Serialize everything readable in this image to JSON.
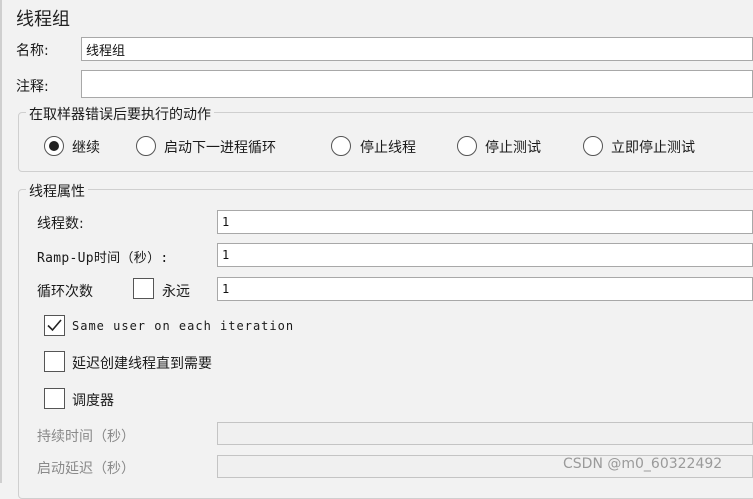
{
  "panel": {
    "title": "线程组"
  },
  "fields": {
    "name_label": "名称:",
    "name_value": "线程组",
    "comment_label": "注释:",
    "comment_value": ""
  },
  "error_action": {
    "legend": "在取样器错误后要执行的动作",
    "options": [
      {
        "label": "继续",
        "selected": true
      },
      {
        "label": "启动下一进程循环",
        "selected": false
      },
      {
        "label": "停止线程",
        "selected": false
      },
      {
        "label": "停止测试",
        "selected": false
      },
      {
        "label": "立即停止测试",
        "selected": false
      }
    ]
  },
  "thread_props": {
    "legend": "线程属性",
    "threads_label": "线程数:",
    "threads_value": "1",
    "rampup_label": "Ramp-Up时间（秒）:",
    "rampup_value": "1",
    "loop_label": "循环次数",
    "forever_label": "永远",
    "forever_checked": false,
    "loop_value": "1",
    "same_user_label": "Same user on each iteration",
    "same_user_checked": true,
    "delay_label": "延迟创建线程直到需要",
    "delay_checked": false,
    "scheduler_label": "调度器",
    "scheduler_checked": false,
    "duration_label": "持续时间（秒）",
    "duration_value": "",
    "startup_delay_label": "启动延迟（秒）",
    "startup_delay_value": ""
  },
  "watermark": "CSDN @m0_60322492"
}
